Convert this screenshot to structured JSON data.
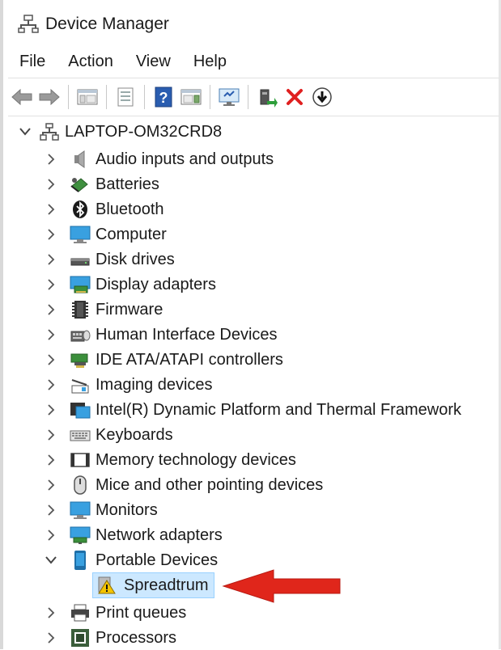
{
  "window": {
    "title": "Device Manager",
    "title_icon": "device-manager-icon"
  },
  "menu": [
    "File",
    "Action",
    "View",
    "Help"
  ],
  "toolbar": [
    {
      "name": "back-button",
      "icon": "back-arrow-icon"
    },
    {
      "name": "forward-button",
      "icon": "forward-arrow-icon"
    },
    {
      "name": "show-hide-console-tree-button",
      "icon": "console-tree-icon"
    },
    {
      "name": "properties-button",
      "icon": "properties-icon"
    },
    {
      "name": "help-button",
      "icon": "help-icon"
    },
    {
      "name": "show-action-pane-button",
      "icon": "action-pane-icon"
    },
    {
      "name": "scan-hardware-changes-button",
      "icon": "monitor-scan-icon"
    },
    {
      "name": "update-driver-button",
      "icon": "update-driver-icon"
    },
    {
      "name": "uninstall-device-button",
      "icon": "red-x-icon"
    },
    {
      "name": "disable-device-button",
      "icon": "down-arrow-circle-icon"
    }
  ],
  "tree": {
    "root": "LAPTOP-OM32CRD8",
    "categories": [
      {
        "label": "Audio inputs and outputs",
        "icon": "speaker-icon"
      },
      {
        "label": "Batteries",
        "icon": "battery-icon"
      },
      {
        "label": "Bluetooth",
        "icon": "bluetooth-icon"
      },
      {
        "label": "Computer",
        "icon": "computer-icon"
      },
      {
        "label": "Disk drives",
        "icon": "disk-drive-icon"
      },
      {
        "label": "Display adapters",
        "icon": "display-adapter-icon"
      },
      {
        "label": "Firmware",
        "icon": "firmware-icon"
      },
      {
        "label": "Human Interface Devices",
        "icon": "hid-icon"
      },
      {
        "label": "IDE ATA/ATAPI controllers",
        "icon": "ide-controller-icon"
      },
      {
        "label": "Imaging devices",
        "icon": "imaging-device-icon"
      },
      {
        "label": "Intel(R) Dynamic Platform and Thermal Framework",
        "icon": "intel-framework-icon"
      },
      {
        "label": "Keyboards",
        "icon": "keyboard-icon"
      },
      {
        "label": "Memory technology devices",
        "icon": "memory-device-icon"
      },
      {
        "label": "Mice and other pointing devices",
        "icon": "mouse-icon"
      },
      {
        "label": "Monitors",
        "icon": "monitor-icon"
      },
      {
        "label": "Network adapters",
        "icon": "network-adapter-icon"
      },
      {
        "label": "Portable Devices",
        "icon": "portable-device-icon",
        "expanded": true,
        "children": [
          {
            "label": "Spreadtrum",
            "icon": "warning-icon",
            "selected": true
          }
        ]
      },
      {
        "label": "Print queues",
        "icon": "printer-icon"
      },
      {
        "label": "Processors",
        "icon": "processor-icon"
      }
    ]
  },
  "colors": {
    "selection": "#cce8ff",
    "annotation_arrow": "#e0261b",
    "uninstall_x": "#e02020"
  }
}
